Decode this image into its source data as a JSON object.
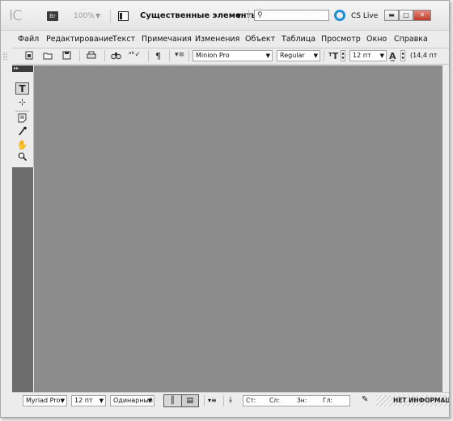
{
  "titlebar": {
    "app_logo": "IC",
    "bridge_label": "Br",
    "zoom": "100%",
    "workspace": "Существенные элементы",
    "search_placeholder": "",
    "cslive": "CS Live",
    "window_buttons": {
      "minimize": "▬",
      "maximize": "□",
      "close": "✕"
    }
  },
  "menu": {
    "items": [
      "Файл",
      "Редактирование",
      "Текст",
      "Примечания",
      "Изменения",
      "Объект",
      "Таблица",
      "Просмотр",
      "Окно",
      "Справка"
    ]
  },
  "control": {
    "font_family": "Minion Pro",
    "font_style": "Regular",
    "font_size": "12 пт",
    "leading": "(14,4 пт"
  },
  "tools": {
    "header": "▸▸",
    "items": [
      "type-tool",
      "position-tool",
      "note-tool",
      "eyedropper-tool",
      "hand-tool",
      "zoom-tool"
    ]
  },
  "status": {
    "font_family": "Myriad Pro",
    "font_size": "12 пт",
    "spacing": "Одинарный",
    "info_labels": [
      "Ст:",
      "Сл:",
      "Зн:",
      "Гл:"
    ],
    "no_info": "НЕТ ИНФОРМАЦИИ"
  },
  "colors": {
    "canvas": "#8c8c8c",
    "left_pane": "#6d6d6d",
    "cslive_ring": "#1a8fd6",
    "close_button": "#c0392b"
  }
}
